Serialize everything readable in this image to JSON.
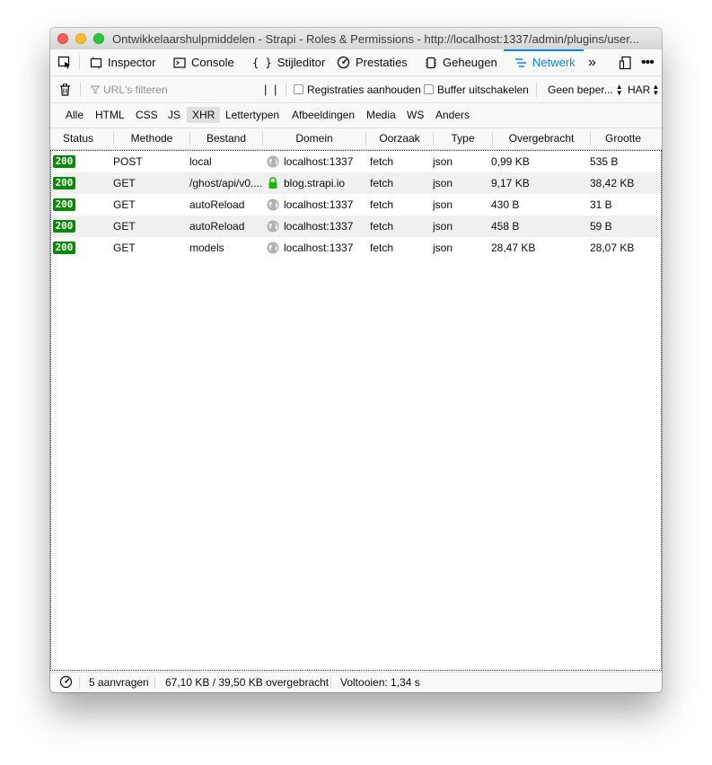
{
  "window": {
    "title": "Ontwikkelaarshulpmiddelen - Strapi - Roles & Permissions - http://localhost:1337/admin/plugins/user..."
  },
  "toolbar": {
    "inspector": "Inspector",
    "console": "Console",
    "style_editor": "Stijleditor",
    "performance": "Prestaties",
    "memory": "Geheugen",
    "network": "Netwerk"
  },
  "filterbar": {
    "url_placeholder": "URL's filteren",
    "persist_logs": "Registraties aanhouden",
    "disable_cache": "Buffer uitschakelen",
    "throttling": "Geen beper...",
    "har": "HAR"
  },
  "type_filters": [
    "Alle",
    "HTML",
    "CSS",
    "JS",
    "XHR",
    "Lettertypen",
    "Afbeeldingen",
    "Media",
    "WS",
    "Anders"
  ],
  "active_type_filter": "XHR",
  "columns": [
    "Status",
    "Methode",
    "Bestand",
    "Domein",
    "Oorzaak",
    "Type",
    "Overgebracht",
    "Grootte"
  ],
  "requests": [
    {
      "status": "200",
      "method": "POST",
      "file": "local",
      "domain": "localhost:1337",
      "secure": false,
      "cause": "fetch",
      "type": "json",
      "transferred": "0,99 KB",
      "size": "535 B"
    },
    {
      "status": "200",
      "method": "GET",
      "file": "/ghost/api/v0....",
      "domain": "blog.strapi.io",
      "secure": true,
      "cause": "fetch",
      "type": "json",
      "transferred": "9,17 KB",
      "size": "38,42 KB"
    },
    {
      "status": "200",
      "method": "GET",
      "file": "autoReload",
      "domain": "localhost:1337",
      "secure": false,
      "cause": "fetch",
      "type": "json",
      "transferred": "430 B",
      "size": "31 B"
    },
    {
      "status": "200",
      "method": "GET",
      "file": "autoReload",
      "domain": "localhost:1337",
      "secure": false,
      "cause": "fetch",
      "type": "json",
      "transferred": "458 B",
      "size": "59 B"
    },
    {
      "status": "200",
      "method": "GET",
      "file": "models",
      "domain": "localhost:1337",
      "secure": false,
      "cause": "fetch",
      "type": "json",
      "transferred": "28,47 KB",
      "size": "28,07 KB"
    }
  ],
  "statusbar": {
    "requests": "5 aanvragen",
    "transferred": "67,10 KB / 39,50 KB overgebracht",
    "finish": "Voltooien: 1,34 s"
  },
  "colors": {
    "accent": "#0a84ff",
    "status_ok": "#058b00",
    "secure_lock": "#12bc00"
  }
}
